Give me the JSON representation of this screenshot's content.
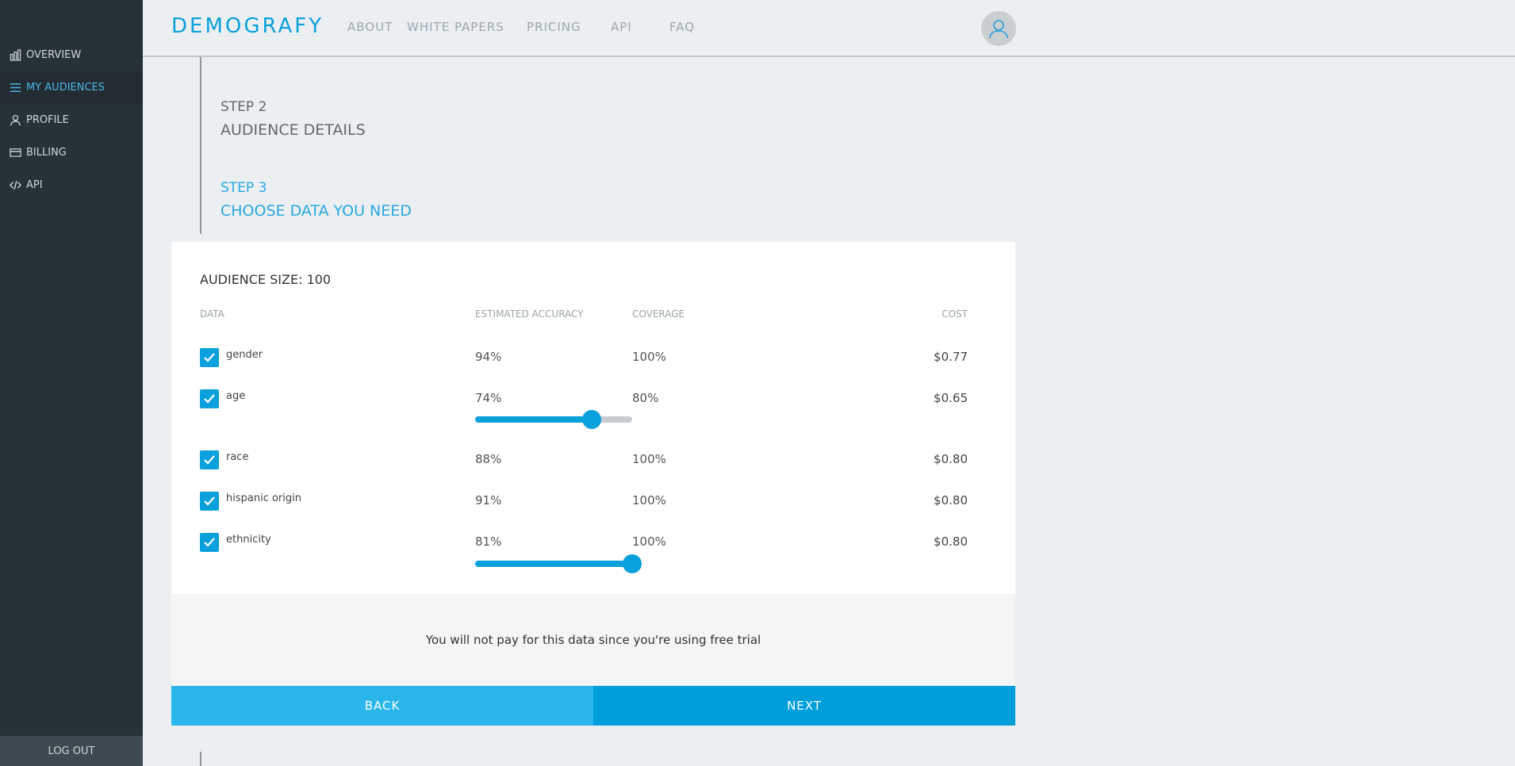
{
  "sidebar": {
    "items": [
      {
        "label": "OVERVIEW",
        "icon": "bar-chart-icon",
        "active": false
      },
      {
        "label": "MY AUDIENCES",
        "icon": "menu-lines-icon",
        "active": true
      },
      {
        "label": "PROFILE",
        "icon": "user-icon",
        "active": false
      },
      {
        "label": "BILLING",
        "icon": "credit-card-icon",
        "active": false
      },
      {
        "label": "API",
        "icon": "code-icon",
        "active": false
      }
    ],
    "logout_label": "LOG OUT"
  },
  "header": {
    "logo": "DEMOGRAFY",
    "nav": [
      "ABOUT",
      "WHITE PAPERS",
      "PRICING",
      "API",
      "FAQ"
    ],
    "avatar_icon": "user-avatar-icon"
  },
  "steps": [
    {
      "number": "STEP 2",
      "title": "AUDIENCE DETAILS"
    },
    {
      "number": "STEP 3",
      "title": "CHOOSE DATA YOU NEED"
    }
  ],
  "card": {
    "audience_size": "AUDIENCE SIZE: 100",
    "columns": {
      "data": "DATA",
      "accuracy": "ESTIMATED ACCURACY",
      "coverage": "COVERAGE",
      "cost": "COST"
    },
    "rows": [
      {
        "label": "gender",
        "checked": true,
        "accuracy": "94%",
        "coverage": "100%",
        "cost": "$0.77",
        "slider": null
      },
      {
        "label": "age",
        "checked": true,
        "accuracy": "74%",
        "coverage": "80%",
        "cost": "$0.65",
        "slider": 0.74
      },
      {
        "label": "race",
        "checked": true,
        "accuracy": "88%",
        "coverage": "100%",
        "cost": "$0.80",
        "slider": null
      },
      {
        "label": "hispanic origin",
        "checked": true,
        "accuracy": "91%",
        "coverage": "100%",
        "cost": "$0.80",
        "slider": null
      },
      {
        "label": "ethnicity",
        "checked": true,
        "accuracy": "81%",
        "coverage": "100%",
        "cost": "$0.80",
        "slider": 1.0
      }
    ]
  },
  "notice": "You will not pay for this data since you're using free trial",
  "buttons": {
    "back": "BACK",
    "next": "NEXT"
  },
  "colors": {
    "accent": "#0aa0dc",
    "sidebar": "#263238",
    "back_button": "#2ab6ea",
    "next_button": "#009fdc"
  }
}
